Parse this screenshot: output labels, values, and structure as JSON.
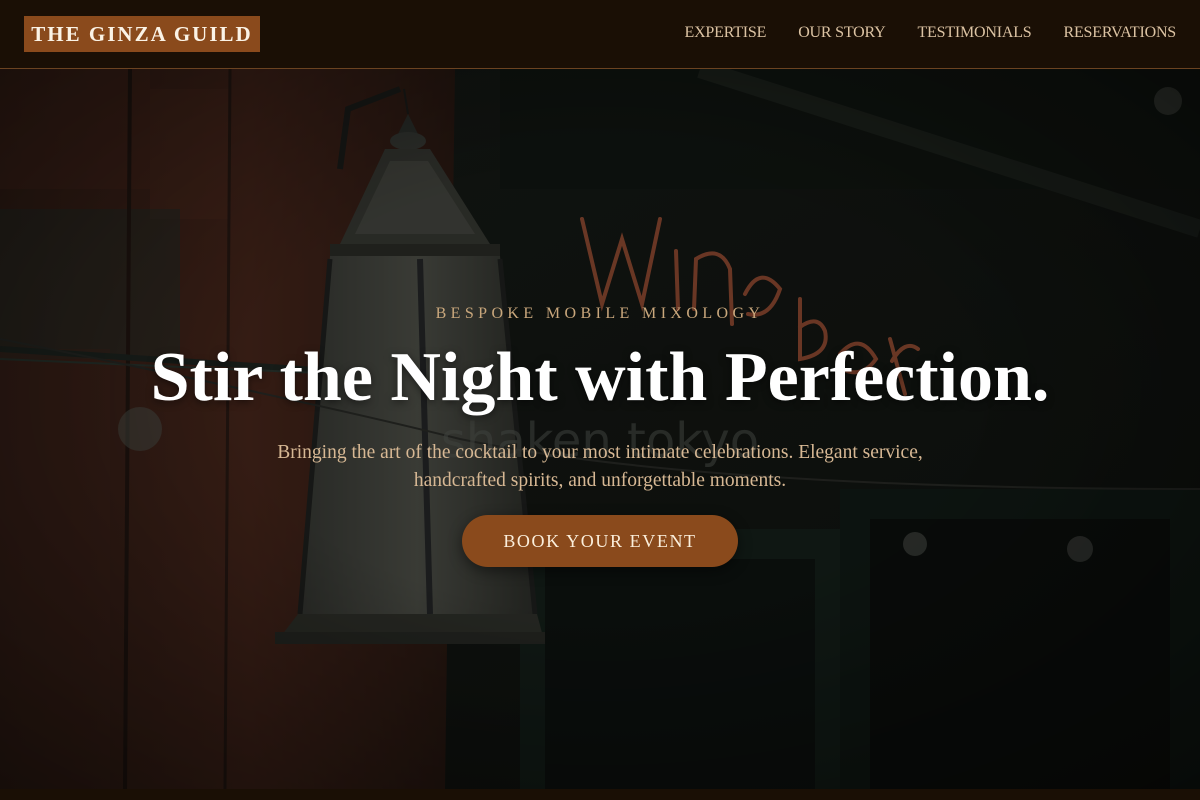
{
  "brand": {
    "name": "THE GINZA GUILD",
    "accent_color": "#8a4a1c",
    "nav_background": "#1a0f05"
  },
  "nav": {
    "links": [
      "EXPERTISE",
      "OUR STORY",
      "TESTIMONIALS",
      "RESERVATIONS"
    ]
  },
  "hero": {
    "eyebrow": "BESPOKE MOBILE MIXOLOGY",
    "headline": "Stir the Night with Perfection.",
    "subcopy_line1": "Bringing the art of the cocktail to your most intimate celebrations. Elegant service,",
    "subcopy_line2": "handcrafted spirits, and unforgettable moments.",
    "cta_label": "BOOK YOUR EVENT",
    "background_photo": "night street with hanging lantern and Wine Bar neon sign",
    "neon_sign_text": "Wine Bar",
    "window_lettering": "shaken tokyo"
  }
}
